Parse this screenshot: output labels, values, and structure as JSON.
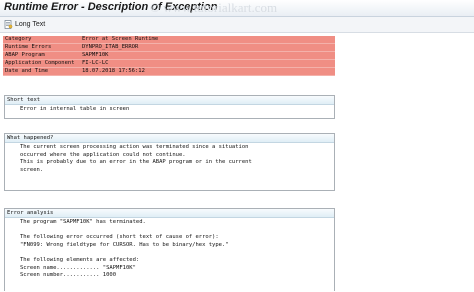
{
  "window": {
    "title": "Runtime Error - Description of Exception",
    "watermark": "© www.tutorialkart.com"
  },
  "toolbar": {
    "long_text_label": "Long Text",
    "long_text_icon": "long-text-icon"
  },
  "header_rows": [
    {
      "label": "Category",
      "value": "Error at Screen Runtime"
    },
    {
      "label": "Runtime Errors",
      "value": "DYNPRO_ITAB_ERROR"
    },
    {
      "label": "ABAP Program",
      "value": "SAPMF10K"
    },
    {
      "label": "Application Component",
      "value": "FI-LC-LC"
    },
    {
      "label": "Date and Time",
      "value": "18.07.2018 17:56:12"
    }
  ],
  "sections": {
    "short_text": {
      "title": "Short text",
      "lines": [
        "Error in internal table in screen"
      ]
    },
    "what_happened": {
      "title": "What happened?",
      "lines": [
        "The current screen processing action was terminated since a situation",
        "occurred where the application could not continue.",
        "This is probably due to an error in the ABAP program or in the current",
        "screen."
      ]
    },
    "error_analysis": {
      "title": "Error analysis",
      "lines": [
        "The program \"SAPMF10K\" has terminated.",
        "",
        "The following error occurred (short text of cause of error):",
        "\"FN099: Wrong fieldtype for CURSOR. Has to be binary/hex type.\"",
        "",
        "The following elements are affected:",
        "Screen name............. \"SAPMF10K\"",
        "Screen number........... 1000"
      ]
    }
  },
  "colors": {
    "header_bg": "#f08e84",
    "section_head": "#dfeef6"
  }
}
